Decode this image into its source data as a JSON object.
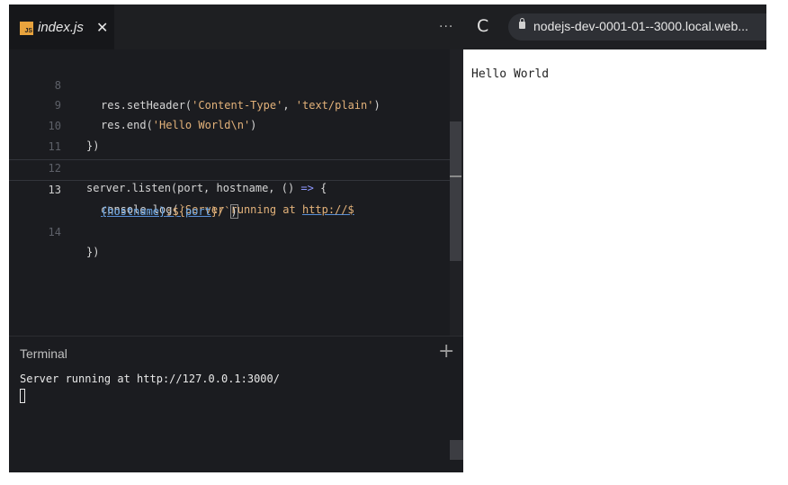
{
  "editor": {
    "tab": {
      "icon_label": "JS",
      "file_name": "index.js",
      "close_glyph": "✕"
    },
    "more_glyph": "···",
    "lines": {
      "l8": {
        "num": "8",
        "a": "res.setHeader(",
        "b": "'Content-Type'",
        "c": ", ",
        "d": "'text/plain'",
        "e": ")"
      },
      "l9": {
        "num": "9",
        "a": "res.end(",
        "b": "'Hello World\\n'",
        "c": ")"
      },
      "l10": {
        "num": "10",
        "a": "})"
      },
      "l11": {
        "num": "11"
      },
      "l12": {
        "num": "12",
        "a": "server.listen(port, hostname, () ",
        "b": "=>",
        "c": " {"
      },
      "l13": {
        "num": "13",
        "a": "console.log(",
        "b": "`Server running at ",
        "c": "http://$"
      },
      "l13w": {
        "a": "{hostname}",
        "b": ":${",
        "c": "port",
        "d": "}/`",
        "e": ")"
      },
      "l14": {
        "num": "14",
        "a": "})"
      }
    }
  },
  "terminal": {
    "title": "Terminal",
    "add_glyph": "+",
    "output": "Server running at http://127.0.0.1:3000/"
  },
  "browser": {
    "reload_glyph": "C",
    "url": "nodejs-dev-0001-01--3000.local.web...",
    "page_text": "Hello World"
  }
}
